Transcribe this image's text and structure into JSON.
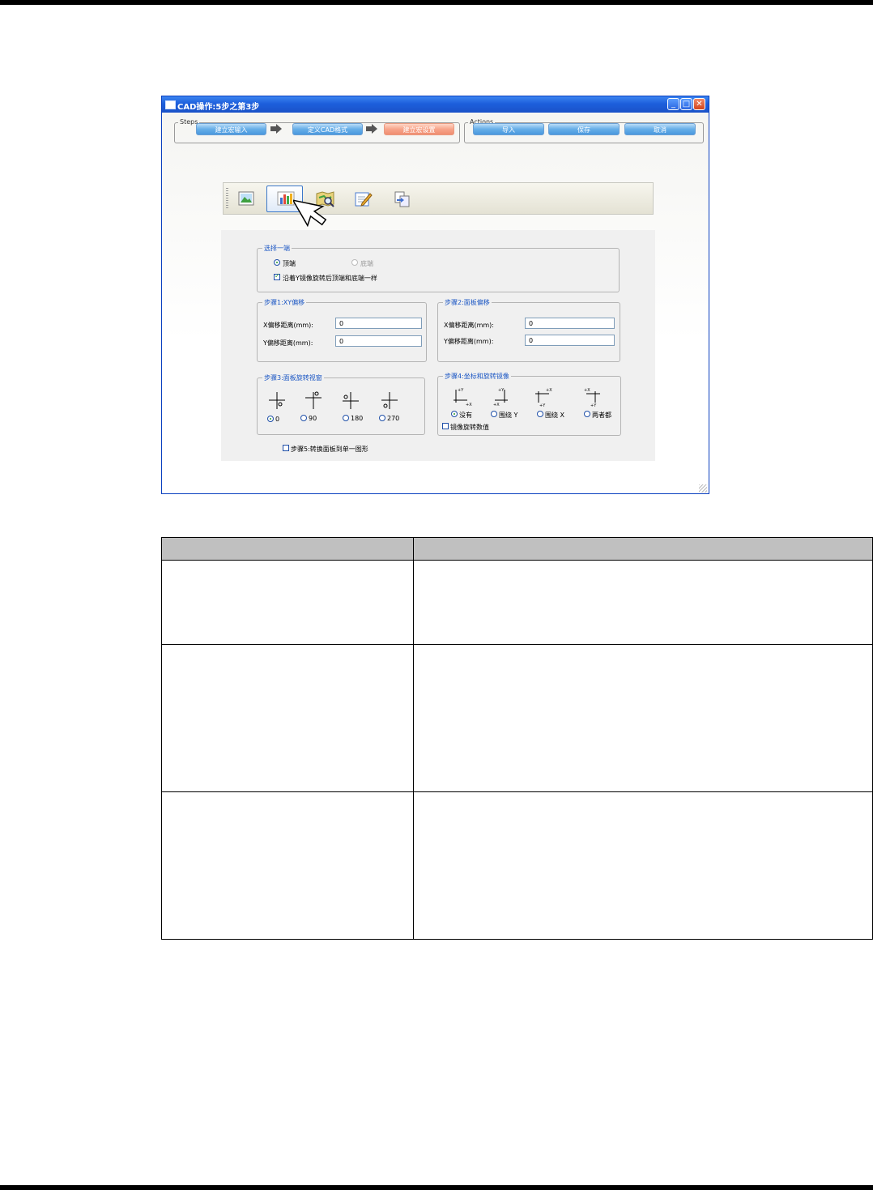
{
  "window": {
    "title": "CAD操作:5步之第3步",
    "steps_legend": "Steps",
    "actions_legend": "Actions",
    "steps": [
      "建立宏输入",
      "定义CAD格式",
      "建立宏设置"
    ],
    "actions": [
      "导入",
      "保存",
      "取消"
    ]
  },
  "toolbar": {
    "buttons": [
      "image-icon",
      "bar-chart-icon",
      "map-search-icon",
      "edit-icon",
      "copy-icon"
    ],
    "selected_index": 1
  },
  "select_side": {
    "legend": "选择一端",
    "top_label": "顶端",
    "bottom_label": "底端",
    "top_selected": true,
    "mirror_check_label": "沿着Y镜像旋转后顶端和底端一样",
    "mirror_checked": true
  },
  "step1": {
    "legend": "步骤1:XY偏移",
    "x_label": "X偏移距离(mm):",
    "x_value": "0",
    "y_label": "Y偏移距离(mm):",
    "y_value": "0"
  },
  "step2": {
    "legend": "步骤2:面板偏移",
    "x_label": "X偏移距离(mm):",
    "x_value": "0",
    "y_label": "Y偏移距离(mm):",
    "y_value": "0"
  },
  "step3": {
    "legend": "步骤3:面板旋转视窗",
    "options": [
      "0",
      "90",
      "180",
      "270"
    ],
    "selected": "0"
  },
  "step4": {
    "legend": "步骤4:坐标和旋转镜像",
    "options": [
      "没有",
      "围绕 Y",
      "围绕 X",
      "两者都"
    ],
    "selected": "没有",
    "mirror_rotation_label": "镜像旋转数值",
    "mirror_rotation_checked": false
  },
  "step5": {
    "label": "步骤5:转换面板到单一图形",
    "checked": false
  },
  "colors": {
    "title_blue": "#1d5fdc",
    "pill_blue": "#66aee8",
    "pill_active": "#f7a48a",
    "legend_blue": "#1c57c4",
    "table_header": "#c0c0c0"
  }
}
